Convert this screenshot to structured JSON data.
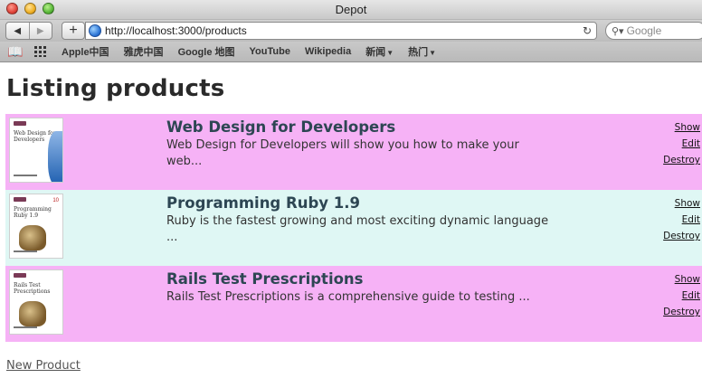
{
  "window": {
    "title": "Depot"
  },
  "toolbar": {
    "back_glyph": "◀",
    "forward_glyph": "▶",
    "add_glyph": "+",
    "url": "http://localhost:3000/products",
    "reload_glyph": "↻",
    "search_glyph": "🔍",
    "search_placeholder": "Google"
  },
  "bookmarks": [
    {
      "label": "Apple中国"
    },
    {
      "label": "雅虎中国"
    },
    {
      "label": "Google 地图"
    },
    {
      "label": "YouTube"
    },
    {
      "label": "Wikipedia"
    },
    {
      "label": "新闻"
    },
    {
      "label": "热门"
    }
  ],
  "page": {
    "heading": "Listing products",
    "new_product_link": "New Product"
  },
  "products": [
    {
      "title": "Web Design for Developers",
      "description_line1": "Web Design for Developers will show you how to make your",
      "description_line2": "web...",
      "cover_text": "Web Design for Developers",
      "actions": {
        "show": "Show",
        "edit": "Edit",
        "destroy": "Destroy"
      }
    },
    {
      "title": "Programming Ruby 1.9",
      "description_line1": "Ruby is the fastest growing and most exciting dynamic language",
      "description_line2": "...",
      "cover_text": "Programming Ruby 1.9",
      "cover_number": "10",
      "actions": {
        "show": "Show",
        "edit": "Edit",
        "destroy": "Destroy"
      }
    },
    {
      "title": "Rails Test Prescriptions",
      "description_line1": "Rails Test Prescriptions is a comprehensive guide to testing ...",
      "description_line2": "",
      "cover_text": "Rails Test Prescriptions",
      "actions": {
        "show": "Show",
        "edit": "Edit",
        "destroy": "Destroy"
      }
    }
  ],
  "colors": {
    "row_odd": "#f6b2f6",
    "row_even": "#dff7f4",
    "title_color": "#2d4653"
  }
}
